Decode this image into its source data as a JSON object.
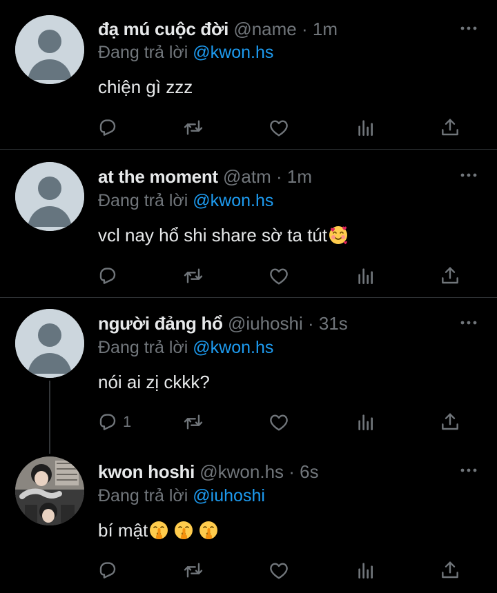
{
  "colors": {
    "background": "#000000",
    "text": "#e7e9ea",
    "muted": "#71767b",
    "link": "#1d9bf0",
    "divider": "#2f3336"
  },
  "tweets": [
    {
      "name": "đạ mú cuộc đời",
      "handle": "@name",
      "time": "1m",
      "reply_prefix": "Đang trả lời",
      "reply_to": "@kwon.hs",
      "text": "chiện gì zzz",
      "emojis": [],
      "reply_count": ""
    },
    {
      "name": "at the moment",
      "handle": "@atm",
      "time": "1m",
      "reply_prefix": "Đang trả lời",
      "reply_to": "@kwon.hs",
      "text": "vcl nay hổ shi share sờ ta tút",
      "emojis": [
        "smiling-face-with-hearts"
      ],
      "reply_count": ""
    },
    {
      "name": "người đảng hổ",
      "handle": "@iuhoshi",
      "time": "31s",
      "reply_prefix": "Đang trả lời",
      "reply_to": "@kwon.hs",
      "text": "nói ai zị ckkk?",
      "emojis": [],
      "reply_count": "1"
    },
    {
      "name": "kwon hoshi",
      "handle": "@kwon.hs",
      "time": "6s",
      "reply_prefix": "Đang trả lời",
      "reply_to": "@iuhoshi",
      "text": "bí mật",
      "emojis": [
        "shushing-face",
        "shushing-face",
        "shushing-face"
      ],
      "reply_count": ""
    }
  ],
  "separator": "·",
  "icons": [
    "reply-icon",
    "retweet-icon",
    "like-icon",
    "views-icon",
    "share-icon",
    "more-icon"
  ]
}
